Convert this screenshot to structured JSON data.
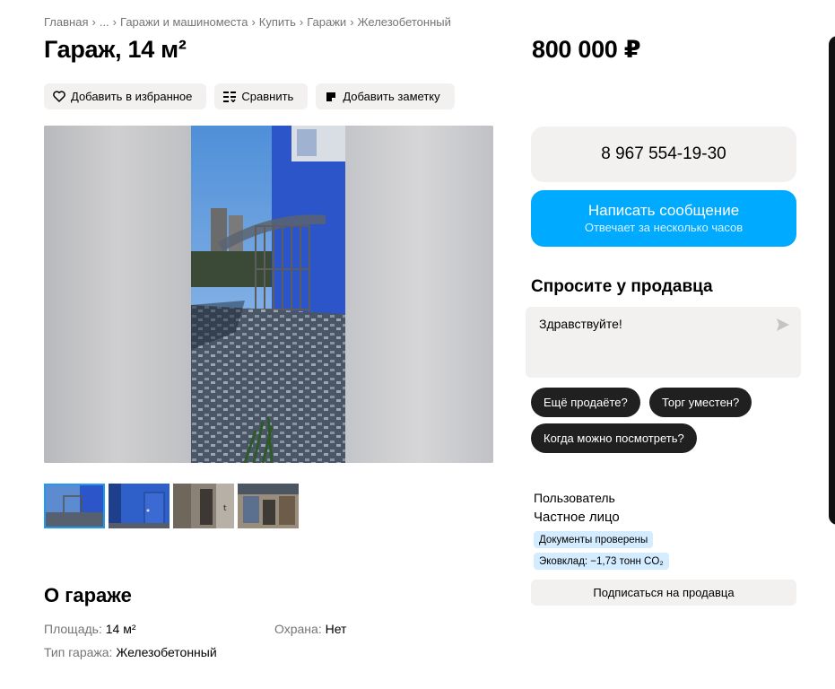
{
  "breadcrumb": [
    "Главная",
    "...",
    "Гаражи и машиноместа",
    "Купить",
    "Гаражи",
    "Железобетонный"
  ],
  "breadcrumb_sep": "›",
  "title": "Гараж, 14 м²",
  "price": "800 000 ₽",
  "actions": {
    "favorite": "Добавить в избранное",
    "compare": "Сравнить",
    "note": "Добавить заметку"
  },
  "contact": {
    "phone": "8 967 554-19-30",
    "message_label": "Написать сообщение",
    "message_sub": "Отвечает за несколько часов"
  },
  "ask": {
    "title": "Спросите у продавца",
    "input_value": "Здравствуйте!",
    "chips": [
      "Ещё продаёте?",
      "Торг уместен?",
      "Когда можно посмотреть?"
    ]
  },
  "seller": {
    "type": "Пользователь",
    "name": "Частное лицо",
    "badges": [
      "Документы проверены",
      "Эковклад: −1,73 тонн CO₂"
    ],
    "subscribe": "Подписаться на продавца"
  },
  "about": {
    "title": "О гараже",
    "specs": [
      {
        "key": "Площадь: ",
        "value": "14 м²"
      },
      {
        "key": "Охрана: ",
        "value": "Нет"
      },
      {
        "key": "Тип гаража: ",
        "value": "Железобетонный"
      }
    ]
  },
  "colors": {
    "accent_blue": "#00aaff",
    "chip_dark": "#202020",
    "light_bg": "#f2f1f0",
    "badge_bg": "#d4ecff"
  }
}
